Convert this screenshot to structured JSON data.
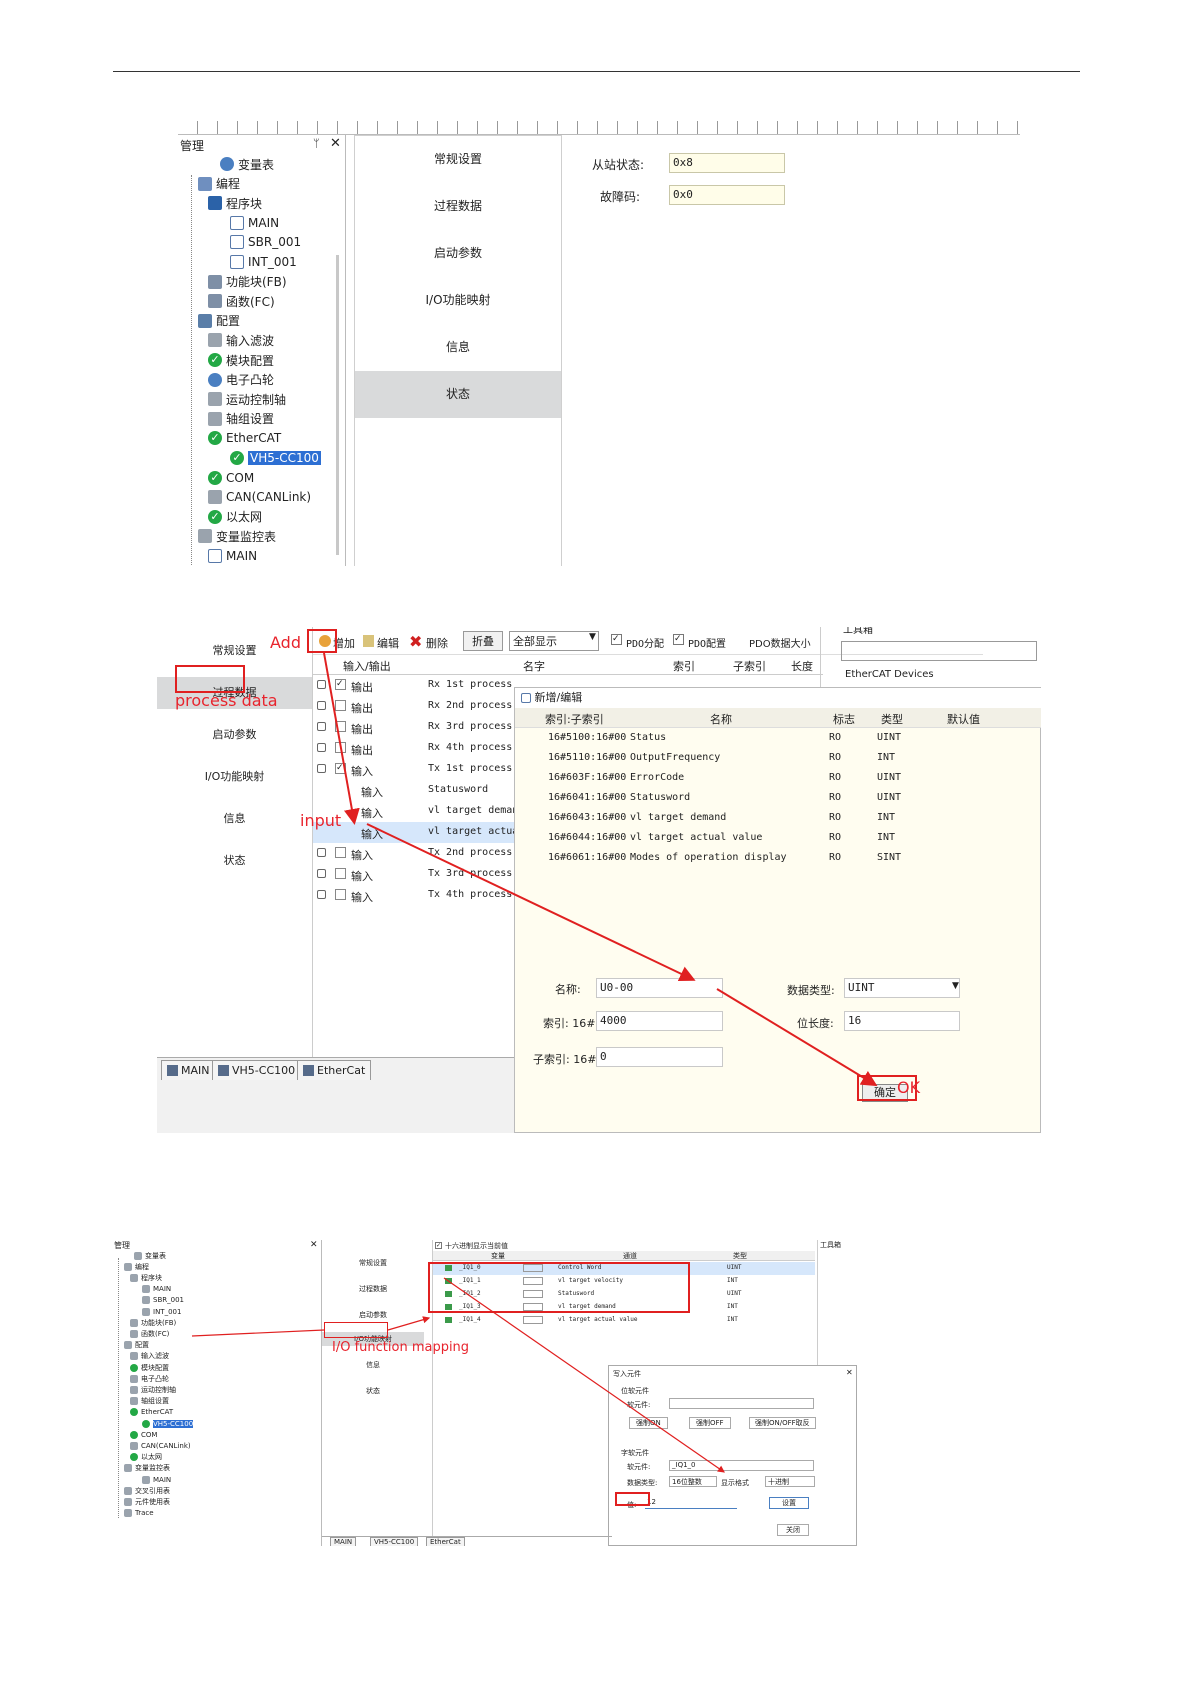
{
  "fig1": {
    "panel_title": "管理",
    "tree": [
      {
        "label": "变量表",
        "icon": "variable-table-icon"
      },
      {
        "label": "编程",
        "icon": "program-icon"
      },
      {
        "label": "程序块",
        "icon": "block-icon"
      },
      {
        "label": "MAIN",
        "icon": "doc-icon"
      },
      {
        "label": "SBR_001",
        "icon": "doc-icon"
      },
      {
        "label": "INT_001",
        "icon": "doc-icon"
      },
      {
        "label": "功能块(FB)",
        "icon": "fb-icon"
      },
      {
        "label": "函数(FC)",
        "icon": "fc-icon"
      },
      {
        "label": "配置",
        "icon": "config-icon"
      },
      {
        "label": "输入滤波",
        "icon": "filter-icon"
      },
      {
        "label": "模块配置",
        "icon": "check-icon"
      },
      {
        "label": "电子凸轮",
        "icon": "cam-icon"
      },
      {
        "label": "运动控制轴",
        "icon": "axis-icon"
      },
      {
        "label": "轴组设置",
        "icon": "gear-icon"
      },
      {
        "label": "EtherCAT",
        "icon": "check-icon"
      },
      {
        "label": "VH5-CC100",
        "icon": "check-icon"
      },
      {
        "label": "COM",
        "icon": "check-icon"
      },
      {
        "label": "CAN(CANLink)",
        "icon": "network-icon"
      },
      {
        "label": "以太网",
        "icon": "check-icon"
      },
      {
        "label": "变量监控表",
        "icon": "monitor-icon"
      },
      {
        "label": "MAIN",
        "icon": "doc-icon"
      }
    ],
    "sidebar": [
      "常规设置",
      "过程数据",
      "启动参数",
      "I/O功能映射",
      "信息",
      "状态"
    ],
    "status_fields": [
      {
        "label": "从站状态:",
        "value": "0x8"
      },
      {
        "label": "故障码:",
        "value": "0x0"
      }
    ]
  },
  "fig2": {
    "sidebar": [
      "常规设置",
      "过程数据",
      "启动参数",
      "I/O功能映射",
      "信息",
      "状态"
    ],
    "toolbar": {
      "add": "增加",
      "edit": "编辑",
      "delete": "删除",
      "fold": "折叠",
      "filter": "全部显示",
      "pdo_assign": "PDO分配",
      "pdo_config": "PDO配置",
      "pdo_size": "PDO数据大小"
    },
    "toolbox_title": "工具箱",
    "toolbox_item": "EtherCAT Devices",
    "pdo_headers": [
      "输入/输出",
      "名字",
      "索引",
      "子索引",
      "长度"
    ],
    "pdo_rows": [
      {
        "io": "输出",
        "name": "Rx 1st process"
      },
      {
        "io": "输出",
        "name": "Rx 2nd process"
      },
      {
        "io": "输出",
        "name": "Rx 3rd process"
      },
      {
        "io": "输出",
        "name": "Rx 4th process"
      },
      {
        "io": "输入",
        "name": "Tx 1st process"
      },
      {
        "io": "输入",
        "name": "Statusword"
      },
      {
        "io": "输入",
        "name": "vl target deman"
      },
      {
        "io": "输入",
        "name": "vl target actua"
      },
      {
        "io": "输入",
        "name": "Tx 2nd process"
      },
      {
        "io": "输入",
        "name": "Tx 3rd process"
      },
      {
        "io": "输入",
        "name": "Tx 4th process"
      }
    ],
    "dialog": {
      "title": "新增/编辑",
      "headers": [
        "索引:子索引",
        "名称",
        "标志",
        "类型",
        "默认值"
      ],
      "rows": [
        {
          "idx": "16#5100:16#00",
          "name": "Status",
          "flag": "RO",
          "type": "UINT"
        },
        {
          "idx": "16#5110:16#00",
          "name": "OutputFrequency",
          "flag": "RO",
          "type": "INT"
        },
        {
          "idx": "16#603F:16#00",
          "name": "ErrorCode",
          "flag": "RO",
          "type": "UINT"
        },
        {
          "idx": "16#6041:16#00",
          "name": "Statusword",
          "flag": "RO",
          "type": "UINT"
        },
        {
          "idx": "16#6043:16#00",
          "name": "vl target demand",
          "flag": "RO",
          "type": "INT"
        },
        {
          "idx": "16#6044:16#00",
          "name": "vl target actual value",
          "flag": "RO",
          "type": "INT"
        },
        {
          "idx": "16#6061:16#00",
          "name": "Modes of operation display",
          "flag": "RO",
          "type": "SINT"
        }
      ],
      "name_label": "名称:",
      "name_value": "U0-00",
      "index_label": "索引: 16#",
      "index_value": "4000",
      "subindex_label": "子索引: 16#",
      "subindex_value": "0",
      "dtype_label": "数据类型:",
      "dtype_value": "UINT",
      "bitlen_label": "位长度:",
      "bitlen_value": "16",
      "ok_label": "确定"
    },
    "tabs": [
      "MAIN",
      "VH5-CC100",
      "EtherCat"
    ],
    "annotations": {
      "add": "Add",
      "process": "process data",
      "input": "input",
      "ok": "OK"
    }
  },
  "fig3": {
    "panel_title": "管理",
    "tree": [
      "变量表",
      "编程",
      "程序块",
      "MAIN",
      "SBR_001",
      "INT_001",
      "功能块(FB)",
      "函数(FC)",
      "配置",
      "输入滤波",
      "模块配置",
      "电子凸轮",
      "运动控制轴",
      "轴组设置",
      "EtherCAT",
      "VH5-CC100",
      "COM",
      "CAN(CANLink)",
      "以太网",
      "变量监控表",
      "MAIN",
      "交叉引用表",
      "元件使用表",
      "Trace"
    ],
    "sidebar": [
      "常规设置",
      "过程数据",
      "启动参数",
      "I/O功能映射",
      "信息",
      "状态"
    ],
    "hex_check": "十六进制显示当前值",
    "headers": [
      "变量",
      "通道",
      "类型"
    ],
    "rows": [
      {
        "var": "_IQ1_0",
        "ch": "Control Word",
        "type": "UINT"
      },
      {
        "var": "_IQ1_1",
        "ch": "vl target velocity",
        "type": "INT"
      },
      {
        "var": "_IQ1_2",
        "ch": "Statusword",
        "type": "UINT"
      },
      {
        "var": "_IQ1_3",
        "ch": "vl target demand",
        "type": "INT"
      },
      {
        "var": "_IQ1_4",
        "ch": "vl target actual value",
        "type": "INT"
      }
    ],
    "toolbox_title": "工具箱",
    "write_dialog": {
      "title": "写入元件",
      "bit_group": "位软元件",
      "bit_soft": "软元件:",
      "force_on": "强制ON",
      "force_off": "强制OFF",
      "force_toggle": "强制ON/OFF取反",
      "word_group": "字软元件",
      "word_soft": "软元件:",
      "word_value": "_IQ1_0",
      "data_type_label": "数据类型:",
      "data_type_value": "16位整数",
      "display_label": "显示格式",
      "display_value": "十进制",
      "val_label": "值:",
      "val_value": "12",
      "set": "设置",
      "close": "关闭"
    },
    "tabs": [
      "MAIN",
      "VH5-CC100",
      "EtherCat"
    ],
    "annotation": "I/O function mapping"
  }
}
